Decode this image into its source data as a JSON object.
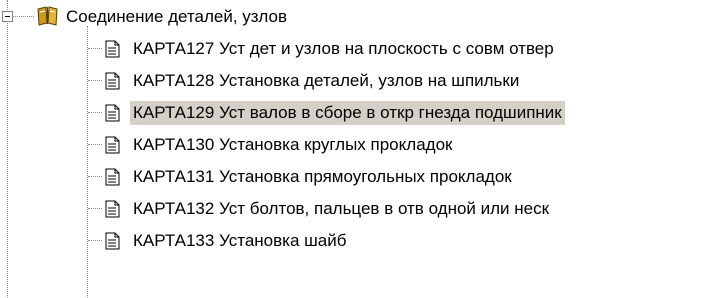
{
  "tree": {
    "parent": {
      "label": "Соединение деталей, узлов",
      "icon": "book-icon",
      "expanded": true
    },
    "children": [
      {
        "label": "КАРТА127 Уст дет и узлов на плоскость с совм отвер",
        "icon": "document-icon",
        "selected": false
      },
      {
        "label": "КАРТА128 Установка деталей, узлов на шпильки",
        "icon": "document-icon",
        "selected": false
      },
      {
        "label": "КАРТА129 Уст валов в сборе в откр гнезда подшипник",
        "icon": "document-icon",
        "selected": true
      },
      {
        "label": "КАРТА130 Установка круглых прокладок",
        "icon": "document-icon",
        "selected": false
      },
      {
        "label": "КАРТА131 Установка прямоугольных прокладок",
        "icon": "document-icon",
        "selected": false
      },
      {
        "label": "КАРТА132 Уст болтов, пальцев в отв одной или неск",
        "icon": "document-icon",
        "selected": false
      },
      {
        "label": "КАРТА133 Установка шайб",
        "icon": "document-icon",
        "selected": false
      }
    ]
  },
  "colors": {
    "selection_background": "#d4d0c8",
    "tree_line": "#8a8a8a",
    "book_icon": "#c89a1e"
  }
}
